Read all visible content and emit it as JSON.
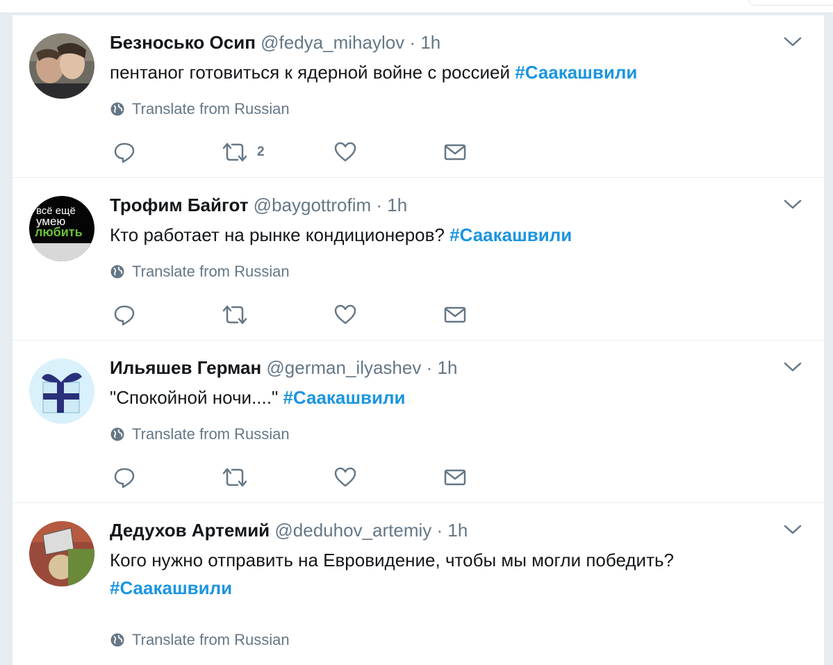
{
  "translate_label": "Translate from Russian",
  "colors": {
    "hashtag": "#1b95e0",
    "muted": "#657786",
    "text": "#14171a",
    "divider": "#e6ecf0"
  },
  "icons": {
    "reply": "reply-icon",
    "retweet": "retweet-icon",
    "like": "heart-icon",
    "dm": "envelope-icon",
    "translate": "globe-icon",
    "menu": "chevron-down-icon"
  },
  "tweets": [
    {
      "name": "Безносько Осип",
      "handle": "@fedya_mihaylov",
      "separator": "·",
      "time": "1h",
      "text": "пентаног готовиться к ядерной войне с россией ",
      "hashtag": "#Саакашвили",
      "retweet_count": "2"
    },
    {
      "name": "Трофим Байгот",
      "handle": "@baygottrofim",
      "separator": "·",
      "time": "1h",
      "text": "Кто работает на рынке кондиционеров? ",
      "hashtag": "#Саакашвили",
      "retweet_count": "",
      "avatar_text": [
        "всё ещё",
        "умею",
        "любить"
      ]
    },
    {
      "name": "Ильяшев Герман",
      "handle": "@german_ilyashev",
      "separator": "·",
      "time": "1h",
      "text": "\"Спокойной ночи....\" ",
      "hashtag": "#Саакашвили",
      "retweet_count": ""
    },
    {
      "name": "Дедухов Артемий",
      "handle": "@deduhov_artemiy",
      "separator": "·",
      "time": "1h",
      "text": "Кого нужно отправить на Евровидение, чтобы мы могли победить? ",
      "hashtag": "#Саакашвили",
      "retweet_count": ""
    }
  ]
}
